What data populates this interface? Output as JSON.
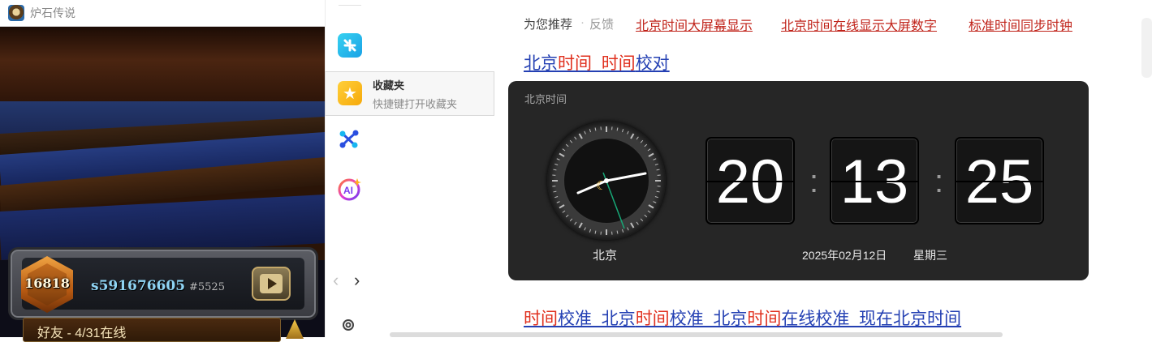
{
  "game_window": {
    "title": "炉石传说",
    "rank": "16818",
    "battletag_name": "s591676605",
    "battletag_number": "#5525",
    "friends_status": "好友 - 4/31在线"
  },
  "sidebar": {
    "tooltip_title": "收藏夹",
    "tooltip_subtitle": "快捷键打开收藏夹",
    "nav_left": "‹",
    "nav_right": "›"
  },
  "recommendations": {
    "label": "为您推荐",
    "separator": "·",
    "feedback": "反馈",
    "links": [
      "北京时间大屏幕显示",
      "北京时间在线显示大屏数字",
      "标准时间同步时钟"
    ]
  },
  "result1": {
    "segments": [
      "北京",
      "时间",
      "_",
      "时间",
      "校对"
    ]
  },
  "clock_widget": {
    "label": "北京时间",
    "city": "北京",
    "hour": "20",
    "minute": "13",
    "second": "25",
    "colon": ":",
    "date": "2025年02月12日",
    "weekday": "星期三"
  },
  "result2": {
    "segments": [
      "时间",
      "校准_北京",
      "时间",
      "校准_北京",
      "时间",
      "在线校准_现在北京时间"
    ]
  },
  "colors": {
    "link_blue": "#2440b3",
    "highlight_red": "#e0301e",
    "rec_red": "#c0231a",
    "card_bg": "#262626"
  },
  "icons": [
    "app-icon-blue",
    "star-icon",
    "graph-icon",
    "ai-icon",
    "chevron-left-icon",
    "chevron-right-icon",
    "gear-icon",
    "moon-icon"
  ]
}
